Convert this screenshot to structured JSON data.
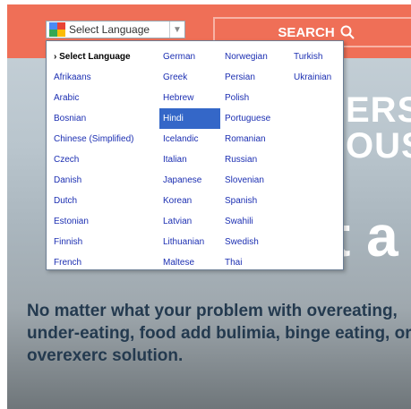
{
  "search": {
    "label": "SEARCH"
  },
  "language_select": {
    "current": "Select Language"
  },
  "language_menu": {
    "columns": [
      [
        "Select Language",
        "Afrikaans",
        "Arabic",
        "Bosnian",
        "Chinese (Simplified)",
        "Czech",
        "Danish",
        "Dutch",
        "Estonian",
        "Finnish",
        "French"
      ],
      [
        "German",
        "Greek",
        "Hebrew",
        "Hindi",
        "Icelandic",
        "Italian",
        "Japanese",
        "Korean",
        "Latvian",
        "Lithuanian",
        "Maltese"
      ],
      [
        "Norwegian",
        "Persian",
        "Polish",
        "Portuguese",
        "Romanian",
        "Russian",
        "Slovenian",
        "Spanish",
        "Swahili",
        "Swedish",
        "Thai"
      ],
      [
        "Turkish",
        "Ukrainian"
      ]
    ],
    "highlighted": "Hindi"
  },
  "heading_fragments": {
    "line1": "ERS",
    "line2": "OUS",
    "line3": "t a"
  },
  "intro": {
    "text": "No matter what your problem with overeating, under-eating, food add bulimia, binge eating, or overexerc solution."
  },
  "colors": {
    "accent": "#ef6f57",
    "link": "#1c2fb2",
    "highlight": "#3467c8",
    "body_text": "#243a4f"
  }
}
